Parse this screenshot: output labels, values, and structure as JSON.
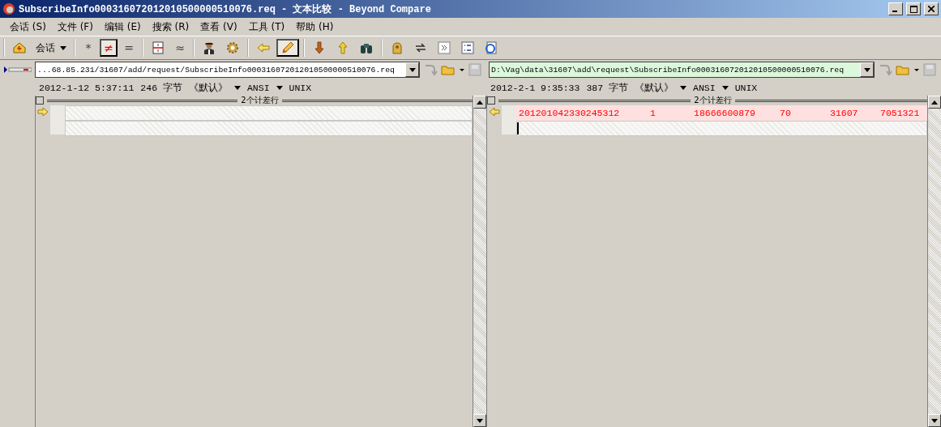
{
  "window": {
    "title": "SubscribeInfo000316072012010500000510076.req - 文本比较 - Beyond Compare"
  },
  "menu": [
    {
      "label": "会话",
      "key": "(S)"
    },
    {
      "label": "文件",
      "key": "(F)"
    },
    {
      "label": "编辑",
      "key": "(E)"
    },
    {
      "label": "搜索",
      "key": "(R)"
    },
    {
      "label": "查看",
      "key": "(V)"
    },
    {
      "label": "工具",
      "key": "(T)"
    },
    {
      "label": "帮助",
      "key": "(H)"
    }
  ],
  "toolbar": [
    [
      {
        "kind": "home"
      },
      {
        "kind": "dropdown",
        "label": "会话"
      }
    ],
    [
      {
        "kind": "text",
        "label": "*",
        "selected": false
      },
      {
        "kind": "text",
        "label": "≠",
        "selected": true
      },
      {
        "kind": "text",
        "label": "=",
        "selected": false
      }
    ],
    [
      {
        "kind": "split"
      },
      {
        "kind": "text",
        "label": "≈",
        "selected": false
      }
    ],
    [
      {
        "kind": "person"
      },
      {
        "kind": "gear"
      }
    ],
    [
      {
        "kind": "left"
      },
      {
        "kind": "pencil",
        "selected": true
      }
    ],
    [
      {
        "kind": "down"
      },
      {
        "kind": "up"
      },
      {
        "kind": "binoculars"
      }
    ],
    [
      {
        "kind": "hand"
      },
      {
        "kind": "swap"
      },
      {
        "kind": "next"
      },
      {
        "kind": "list"
      },
      {
        "kind": "page"
      }
    ]
  ],
  "panes": [
    {
      "path": "...68.85.231/31607/add/request/SubscribeInfo000316072012010500000510076.req",
      "path_highlight": false,
      "date": "2012-1-12 5:37:11",
      "size": "246",
      "unit": "字节",
      "encoding": "《默认》",
      "charset": "ANSI",
      "line_ending": "UNIX",
      "section": "2个计差行",
      "lines": [
        {
          "kind": "blank"
        },
        {
          "kind": "blank"
        }
      ]
    },
    {
      "path": "D:\\Vag\\data\\31607\\add\\request\\SubscribeInfo000316072012010500000510076.req",
      "path_highlight": true,
      "date": "2012-2-1 9:35:33",
      "size": "387",
      "unit": "字节",
      "encoding": "《默认》",
      "charset": "ANSI",
      "line_ending": "UNIX",
      "section": "2个计差行",
      "lines": [
        {
          "kind": "diff",
          "cells": [
            "201201042330245312",
            "1",
            "18666600879",
            "70",
            "31607",
            "7051321"
          ]
        },
        {
          "kind": "blank"
        }
      ]
    }
  ]
}
